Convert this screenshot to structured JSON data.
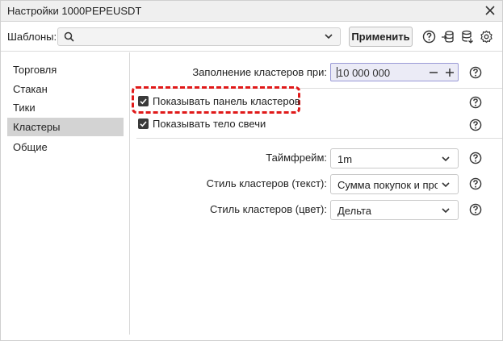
{
  "window": {
    "title": "Настройки 1000PEPEUSDT"
  },
  "toolbar": {
    "templates_label": "Шаблоны:",
    "template_value": "",
    "apply_label": "Применить",
    "icons": [
      "help-circle-icon",
      "import-icon",
      "database-save-icon",
      "settings-gear-icon"
    ]
  },
  "sidebar": {
    "items": [
      {
        "label": "Торговля",
        "active": false
      },
      {
        "label": "Стакан",
        "active": false
      },
      {
        "label": "Тики",
        "active": false
      },
      {
        "label": "Кластеры",
        "active": true
      },
      {
        "label": "Общие",
        "active": false
      }
    ]
  },
  "settings": {
    "fill_label": "Заполнение кластеров при:",
    "fill_value": "10 000 000",
    "show_panel_label": "Показывать панель кластеров",
    "show_panel_checked": true,
    "show_body_label": "Показывать тело свечи",
    "show_body_checked": true,
    "timeframe_label": "Таймфрейм:",
    "timeframe_value": "1m",
    "style_text_label": "Стиль кластеров (текст):",
    "style_text_value": "Сумма покупок и продаж",
    "style_color_label": "Стиль кластеров (цвет):",
    "style_color_value": "Дельта"
  },
  "colors": {
    "highlight": "#e01919",
    "active_item": "#d3d3d3",
    "input_focus": "#9a9ad6"
  }
}
